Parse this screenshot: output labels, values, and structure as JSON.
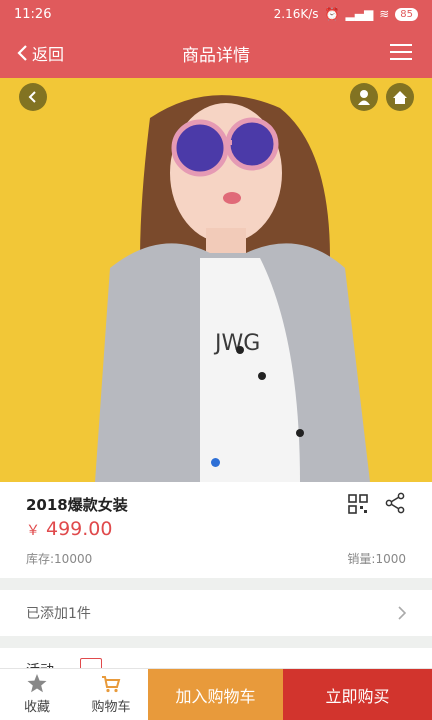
{
  "status": {
    "time": "11:26",
    "speed": "2.16K/s",
    "battery": "85"
  },
  "nav": {
    "back_label": "返回",
    "title": "商品详情"
  },
  "product": {
    "title": "2018爆款女装",
    "currency": "￥",
    "price": "499.00",
    "stock": "库存:10000",
    "sales": "销量:1000"
  },
  "added": {
    "label": "已添加1件"
  },
  "promo": {
    "label": "活动"
  },
  "tabbar": {
    "favorite": "收藏",
    "cart": "购物车",
    "add_to_cart": "加入购物车",
    "buy_now": "立即购买"
  },
  "colors": {
    "accent": "#e05a5c",
    "price": "#e04a4c",
    "add_cart": "#e89a3b",
    "buy_now": "#d2342d",
    "hero_bg": "#f2c737"
  },
  "icons": [
    "back-icon",
    "menu-icon",
    "user-icon",
    "home-icon",
    "qr-icon",
    "share-icon",
    "chevron-right-icon",
    "star-icon",
    "cart-icon"
  ]
}
